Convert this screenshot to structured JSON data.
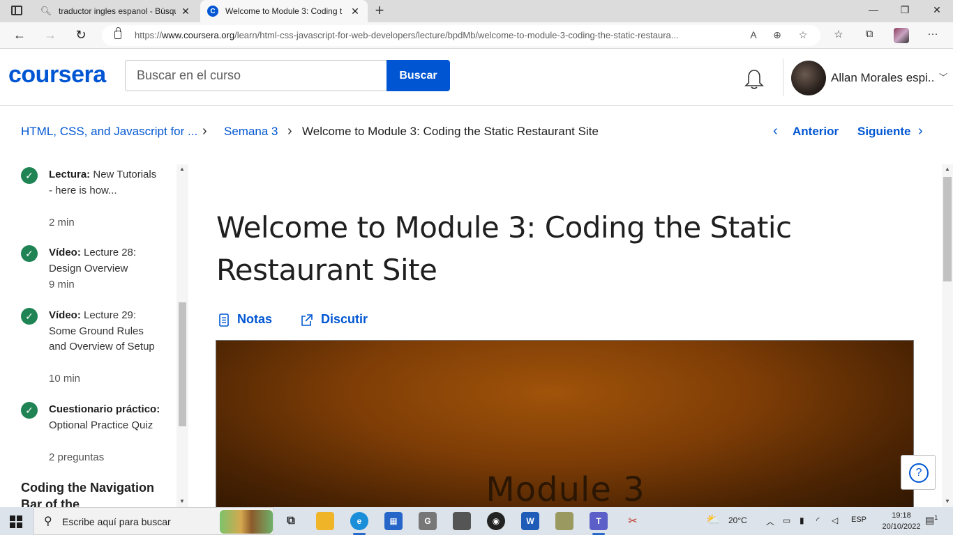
{
  "browser": {
    "tabs": [
      {
        "title": "traductor ingles espanol - Búsqu",
        "icon": "search-icon",
        "active": false
      },
      {
        "title": "Welcome to Module 3: Coding th",
        "icon": "coursera-favicon",
        "active": true
      }
    ],
    "url_prefix": "https://",
    "url_domain": "www.coursera.org",
    "url_path": "/learn/html-css-javascript-for-web-developers/lecture/bpdMb/welcome-to-module-3-coding-the-static-restaura..."
  },
  "header": {
    "logo": "coursera",
    "search_placeholder": "Buscar en el curso",
    "search_button": "Buscar",
    "user_name": "Allan Morales espi..."
  },
  "breadcrumb": {
    "course": "HTML, CSS, and Javascript for ...",
    "week": "Semana 3",
    "current": "Welcome to Module 3: Coding the Static Restaurant Site",
    "prev": "Anterior",
    "next": "Siguiente"
  },
  "sidebar": {
    "items": [
      {
        "kind": "Lectura:",
        "title": " New Tutorials - here is how...",
        "meta": "2 min"
      },
      {
        "kind": "Vídeo:",
        "title": " Lecture 28: Design Overview",
        "meta": "9 min"
      },
      {
        "kind": "Vídeo:",
        "title": " Lecture 29: Some Ground Rules and Overview of Setup",
        "meta": "10 min"
      },
      {
        "kind": "Cuestionario práctico:",
        "title": " Optional Practice Quiz",
        "meta": "2 preguntas"
      }
    ],
    "section_title": "Coding the Navigation Bar of the"
  },
  "main": {
    "title": "Welcome to Module 3: Coding the Static Restaurant Site",
    "notes": "Notas",
    "discuss": "Discutir",
    "video_text": "Module 3",
    "help": "?"
  },
  "taskbar": {
    "search": "Escribe aquí para buscar",
    "weather": "20°C",
    "language": "ESP",
    "time": "19:18",
    "date": "20/10/2022",
    "notification_count": "1"
  },
  "colors": {
    "brand": "#0056d2",
    "complete": "#1f8354",
    "video_center": "#a0530a",
    "video_edge": "#2e1602"
  }
}
